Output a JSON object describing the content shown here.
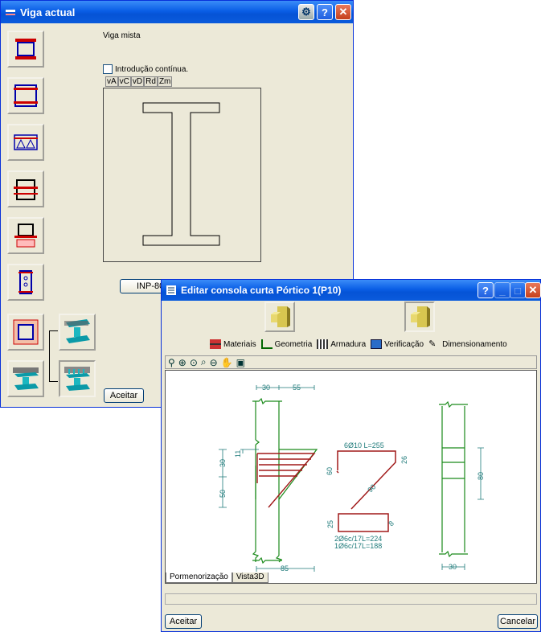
{
  "win1": {
    "title": "Viga actual",
    "subtitle": "Viga mista",
    "checkbox_label": "Introdução contínua.",
    "tabs": [
      "vA",
      "vC",
      "vD",
      "Rd",
      "Zm"
    ],
    "section_button": "INP-80",
    "accept": "Aceitar"
  },
  "win2": {
    "title": "Editar consola curta Pórtico 1(P10)",
    "toolbar": [
      "Materiais",
      "Geometria",
      "Armadura",
      "Verificação",
      "Dimensionamento"
    ],
    "bottom_tabs": [
      "Pormenorização",
      "Vista3D"
    ],
    "accept": "Aceitar",
    "cancel": "Cancelar"
  },
  "drawing": {
    "dim_30_top": "30",
    "dim_55": "55",
    "dim_11": "11",
    "dim_30_left": "30",
    "dim_50": "50",
    "dim_85": "85",
    "bar_main": "6Ø10 L=255",
    "bar_26": "26",
    "bar_60": "60",
    "bar_90": "90",
    "bar_25": "25",
    "bar_8": "8",
    "stirrup_1": "2Ø6c/17L=224",
    "stirrup_2": "1Ø6c/17L=188",
    "dim_80": "80",
    "dim_30_right": "30"
  },
  "colors": {
    "rebar": "#a01818",
    "column": "#1a8a1a",
    "dim": "#1e7a7a"
  }
}
